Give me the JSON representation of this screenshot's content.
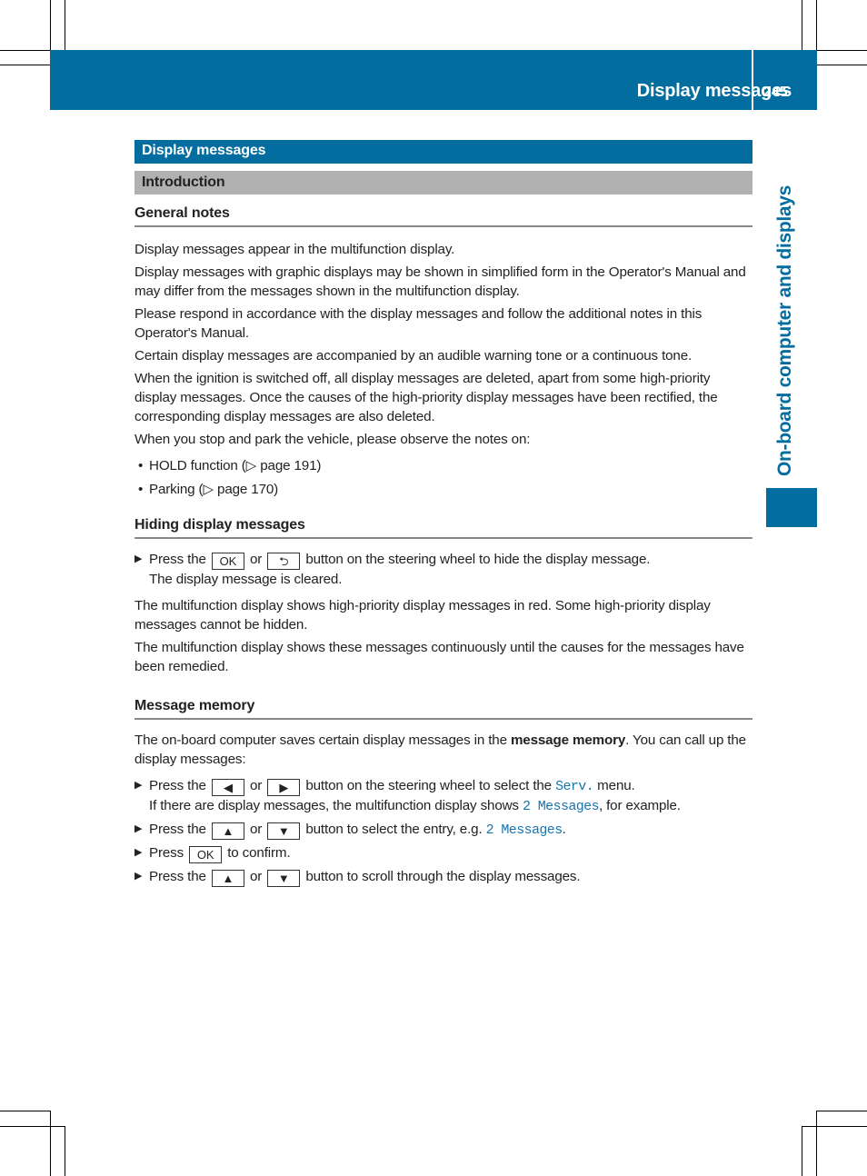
{
  "header": {
    "title": "Display messages",
    "page_number": "245",
    "accent_color": "#046d9f"
  },
  "side_tab": {
    "label": "On-board computer and displays"
  },
  "section": {
    "title": "Display messages",
    "subsection": "Introduction"
  },
  "general_notes": {
    "heading": "General notes",
    "paragraphs": [
      "Display messages appear in the multifunction display.",
      "Display messages with graphic displays may be shown in simplified form in the Operator's Manual and may differ from the messages shown in the multifunction display.",
      "Please respond in accordance with the display messages and follow the additional notes in this Operator's Manual.",
      "Certain display messages are accompanied by an audible warning tone or a continuous tone.",
      "When the ignition is switched off, all display messages are deleted, apart from some high-priority display messages. Once the causes of the high-priority display messages have been rectified, the corresponding display messages are also deleted.",
      "When you stop and park the vehicle, please observe the notes on:"
    ],
    "bullets": [
      {
        "text": "HOLD function (",
        "ref_icon": "▷",
        "ref": " page 191)"
      },
      {
        "text": "Parking (",
        "ref_icon": "▷",
        "ref": " page 170)"
      }
    ]
  },
  "hiding": {
    "heading": "Hiding display messages",
    "step": {
      "pre": "Press the",
      "key1": "OK",
      "or": "or",
      "key2": "⮌",
      "post": "button on the steering wheel to hide the display message.",
      "result": "The display message is cleared."
    },
    "paragraphs": [
      "The multifunction display shows high-priority display messages in red. Some high-priority display messages cannot be hidden.",
      "The multifunction display shows these messages continuously until the causes for the messages have been remedied."
    ]
  },
  "memory": {
    "heading": "Message memory",
    "intro_pre": "The on-board computer saves certain display messages in the ",
    "intro_bold": "message memory",
    "intro_post": ". You can call up the display messages:",
    "steps": [
      {
        "pre": "Press the",
        "key1": "◀",
        "or": "or",
        "key2": "▶",
        "post": "button on the steering wheel to select the",
        "mono": "Serv.",
        "post2": "menu.",
        "result_pre": "If there are display messages, the multifunction display shows",
        "result_mono": "2 Messages",
        "result_post": ", for example."
      },
      {
        "pre": "Press the",
        "key1": "▲",
        "or": "or",
        "key2": "▼",
        "post": "button to select the entry, e.g.",
        "mono": "2 Messages",
        "post2": "."
      },
      {
        "pre": "Press",
        "key1": "OK",
        "post": "to confirm."
      },
      {
        "pre": "Press the",
        "key1": "▲",
        "or": "or",
        "key2": "▼",
        "post": "button to scroll through the display messages."
      }
    ]
  }
}
